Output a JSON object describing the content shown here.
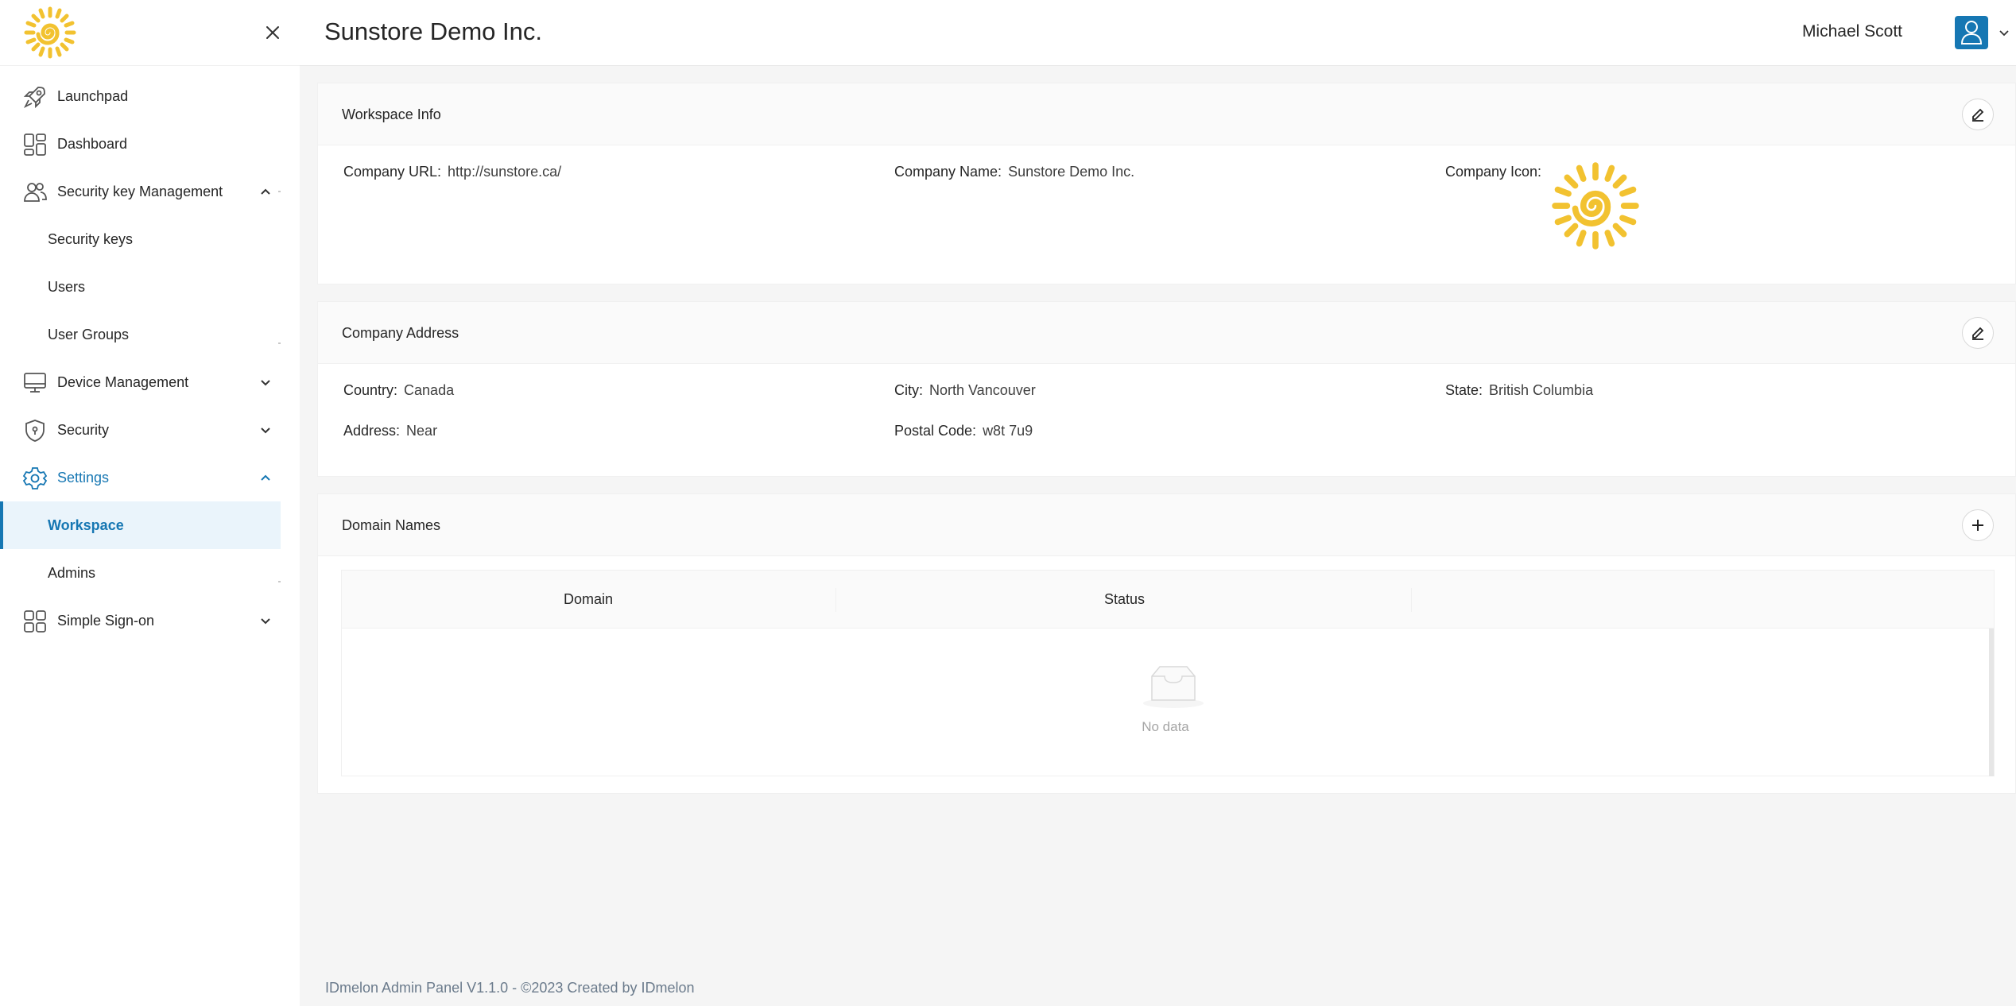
{
  "sidebar": {
    "items": [
      {
        "label": "Launchpad",
        "icon": "rocket-icon"
      },
      {
        "label": "Dashboard",
        "icon": "dashboard-icon"
      },
      {
        "label": "Security key Management",
        "icon": "users-icon"
      },
      {
        "label": "Security keys"
      },
      {
        "label": "Users"
      },
      {
        "label": "User Groups"
      },
      {
        "label": "Device Management",
        "icon": "monitor-icon"
      },
      {
        "label": "Security",
        "icon": "shield-icon"
      },
      {
        "label": "Settings",
        "icon": "gear-icon"
      },
      {
        "label": "Workspace"
      },
      {
        "label": "Admins"
      },
      {
        "label": "Simple Sign-on",
        "icon": "apps-icon"
      }
    ]
  },
  "header": {
    "title": "Sunstore Demo Inc.",
    "user_name": "Michael Scott"
  },
  "workspace_info": {
    "title": "Workspace Info",
    "company_url_label": "Company URL:",
    "company_url": "http://sunstore.ca/",
    "company_name_label": "Company Name:",
    "company_name": "Sunstore Demo Inc.",
    "company_icon_label": "Company Icon:"
  },
  "company_address": {
    "title": "Company Address",
    "country_label": "Country:",
    "country": "Canada",
    "city_label": "City:",
    "city": "North Vancouver",
    "state_label": "State:",
    "state": "British Columbia",
    "address_label": "Address:",
    "address": "Near",
    "postal_label": "Postal Code:",
    "postal": "w8t 7u9"
  },
  "domain_names": {
    "title": "Domain Names",
    "columns": [
      "Domain",
      "Status"
    ],
    "empty_text": "No data"
  },
  "footer": "IDmelon Admin Panel V1.1.0 - ©2023 Created by IDmelon",
  "colors": {
    "accent": "#1677b3",
    "logo": "#f2c230"
  }
}
